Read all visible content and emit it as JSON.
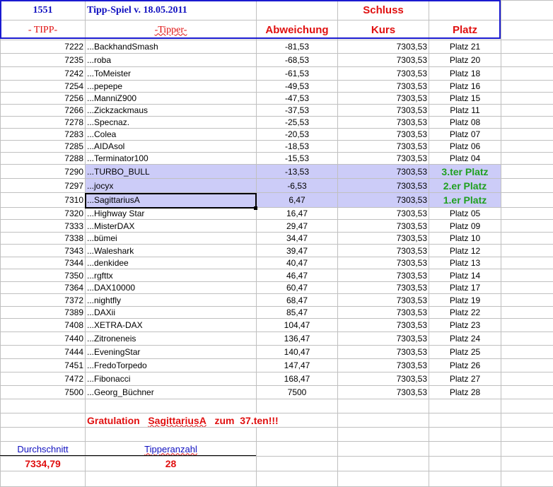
{
  "header": {
    "id": "1551",
    "title": "Tipp-Spiel v. 18.05.2011",
    "schluss": "Schluss",
    "col_tipp": "- TIPP-",
    "col_tipper": "-Tipper-",
    "col_abweichung": "Abweichung",
    "col_kurs": "Kurs",
    "col_platz": "Platz"
  },
  "rows": [
    {
      "tipp": "7222",
      "name": "...BackhandSmash",
      "abw": "-81,53",
      "kurs": "7303,53",
      "platz": "Platz 21"
    },
    {
      "tipp": "7235",
      "name": "...roba",
      "abw": "-68,53",
      "kurs": "7303,53",
      "platz": "Platz 20"
    },
    {
      "tipp": "7242",
      "name": "...ToMeister",
      "abw": "-61,53",
      "kurs": "7303,53",
      "platz": "Platz 18"
    },
    {
      "tipp": "7254",
      "name": "...pepepe",
      "abw": "-49,53",
      "kurs": "7303,53",
      "platz": "Platz 16"
    },
    {
      "tipp": "7256",
      "name": "...ManniZ900",
      "abw": "-47,53",
      "kurs": "7303,53",
      "platz": "Platz 15"
    },
    {
      "tipp": "7266",
      "name": "...Zickzackmaus",
      "abw": "-37,53",
      "kurs": "7303,53",
      "platz": "Platz 11"
    },
    {
      "tipp": "7278",
      "name": "...Specnaz.",
      "abw": "-25,53",
      "kurs": "7303,53",
      "platz": "Platz 08"
    },
    {
      "tipp": "7283",
      "name": "...Colea",
      "abw": "-20,53",
      "kurs": "7303,53",
      "platz": "Platz 07"
    },
    {
      "tipp": "7285",
      "name": "...AIDAsol",
      "abw": "-18,53",
      "kurs": "7303,53",
      "platz": "Platz 06"
    },
    {
      "tipp": "7288",
      "name": "...Terminator100",
      "abw": "-15,53",
      "kurs": "7303,53",
      "platz": "Platz 04"
    },
    {
      "tipp": "7290",
      "name": "...TURBO_BULL",
      "abw": "-13,53",
      "kurs": "7303,53",
      "platz": "3.ter Platz",
      "highlight": true
    },
    {
      "tipp": "7297",
      "name": "...jocyx",
      "abw": "-6,53",
      "kurs": "7303,53",
      "platz": "2.er Platz",
      "highlight": true
    },
    {
      "tipp": "7310",
      "name": "...SagittariusA",
      "abw": "6,47",
      "kurs": "7303,53",
      "platz": "1.er Platz",
      "highlight": true
    },
    {
      "tipp": "7320",
      "name": "...Highway Star",
      "abw": "16,47",
      "kurs": "7303,53",
      "platz": "Platz 05"
    },
    {
      "tipp": "7333",
      "name": "...MisterDAX",
      "abw": "29,47",
      "kurs": "7303,53",
      "platz": "Platz 09"
    },
    {
      "tipp": "7338",
      "name": "...bümei",
      "abw": "34,47",
      "kurs": "7303,53",
      "platz": "Platz 10"
    },
    {
      "tipp": "7343",
      "name": "...Waleshark",
      "abw": "39,47",
      "kurs": "7303,53",
      "platz": "Platz 12"
    },
    {
      "tipp": "7344",
      "name": "...denkidee",
      "abw": "40,47",
      "kurs": "7303,53",
      "platz": "Platz 13"
    },
    {
      "tipp": "7350",
      "name": "...rgfttx",
      "abw": "46,47",
      "kurs": "7303,53",
      "platz": "Platz 14"
    },
    {
      "tipp": "7364",
      "name": "...DAX10000",
      "abw": "60,47",
      "kurs": "7303,53",
      "platz": "Platz 17"
    },
    {
      "tipp": "7372",
      "name": "...nightfly",
      "abw": "68,47",
      "kurs": "7303,53",
      "platz": "Platz 19"
    },
    {
      "tipp": "7389",
      "name": "...DAXii",
      "abw": "85,47",
      "kurs": "7303,53",
      "platz": "Platz 22"
    },
    {
      "tipp": "7408",
      "name": "...XETRA-DAX",
      "abw": "104,47",
      "kurs": "7303,53",
      "platz": "Platz 23"
    },
    {
      "tipp": "7440",
      "name": "...Zitroneneis",
      "abw": "136,47",
      "kurs": "7303,53",
      "platz": "Platz 24"
    },
    {
      "tipp": "7444",
      "name": "...EveningStar",
      "abw": "140,47",
      "kurs": "7303,53",
      "platz": "Platz 25"
    },
    {
      "tipp": "7451",
      "name": "...FredoTorpedo",
      "abw": "147,47",
      "kurs": "7303,53",
      "platz": "Platz 26"
    },
    {
      "tipp": "7472",
      "name": "...Fibonacci",
      "abw": "168,47",
      "kurs": "7303,53",
      "platz": "Platz 27"
    },
    {
      "tipp": "7500",
      "name": "...Georg_Büchner",
      "abw": "7500",
      "kurs": "7303,53",
      "platz": "Platz 28"
    }
  ],
  "footer": {
    "grat_word": "Gratulation",
    "grat_name": "SagittariusA",
    "grat_zum": "zum",
    "grat_count": "37.ten!!!",
    "avg_label": "Durchschnitt",
    "avg_value": "7334,79",
    "count_label": "Tipperanzahl",
    "count_value": "28"
  },
  "colors": {
    "highlight": "#ccccf8",
    "header_blue": "#1010c0",
    "accent_red": "#e01010",
    "winner_green": "#20a020"
  }
}
